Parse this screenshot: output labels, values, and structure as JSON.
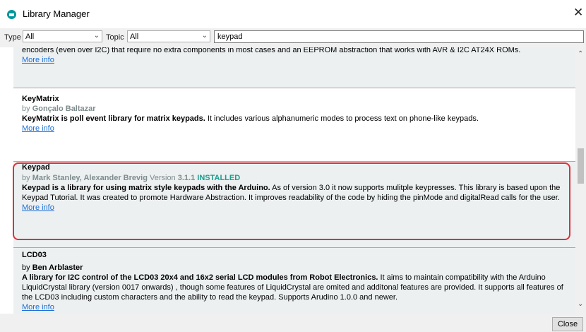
{
  "window": {
    "title": "Library Manager",
    "close_glyph": "✕"
  },
  "filters": {
    "type_label": "Type",
    "type_value": "All",
    "topic_label": "Topic",
    "topic_value": "All",
    "search_value": "keypad"
  },
  "libraries": [
    {
      "truncated_text": "encoders (even over I2C) that require no extra components in most cases and an EEPROM abstraction that works with AVR & I2C AT24X ROMs.",
      "more": "More info"
    },
    {
      "name": "KeyMatrix",
      "by": "by",
      "author": "Gonçalo Baltazar",
      "desc_bold": "KeyMatrix is poll event library for matrix keypads.",
      "desc_rest": " It includes various alphanumeric modes to process text on phone-like keypads.",
      "more": "More info"
    },
    {
      "name": "Keypad",
      "by": "by",
      "author": "Mark Stanley, Alexander Brevig",
      "version_label": "Version",
      "version": "3.1.1",
      "status": "INSTALLED",
      "desc_bold": "Keypad is a library for using matrix style keypads with the Arduino.",
      "desc_rest": " As of version 3.0 it now supports mulitple keypresses. This library is based upon the Keypad Tutorial. It was created to promote Hardware Abstraction. It improves readability of the code by hiding the pinMode and digitalRead calls for the user.",
      "more": "More info"
    },
    {
      "name": "LCD03",
      "by": "by",
      "author": "Ben Arblaster",
      "desc_bold": "A library for I2C control of the LCD03 20x4 and 16x2 serial LCD modules from Robot Electronics.",
      "desc_rest": " It aims to maintain compatibility with the Arduino LiquidCrystal library (version 0017 onwards) , though some features of LiquidCrystal are omited and additonal features are provided. It supports all features of the LCD03 including custom characters and the ability to read the keypad. Supports Arudino 1.0.0 and newer.",
      "more": "More info"
    }
  ],
  "buttons": {
    "close": "Close"
  },
  "colors": {
    "highlight": "#e0303a",
    "installed": "#1a9e8f",
    "link": "#1d6fd8",
    "app_icon": "#00979c"
  }
}
